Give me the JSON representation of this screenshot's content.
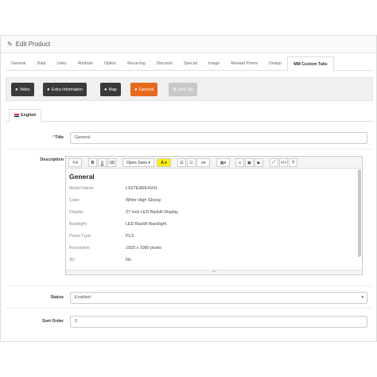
{
  "header": {
    "title": "Edit Product"
  },
  "tabs": [
    {
      "label": "General",
      "active": false
    },
    {
      "label": "Data",
      "active": false
    },
    {
      "label": "Links",
      "active": false
    },
    {
      "label": "Attribute",
      "active": false
    },
    {
      "label": "Option",
      "active": false
    },
    {
      "label": "Recurring",
      "active": false
    },
    {
      "label": "Discount",
      "active": false
    },
    {
      "label": "Special",
      "active": false
    },
    {
      "label": "Image",
      "active": false
    },
    {
      "label": "Reward Points",
      "active": false
    },
    {
      "label": "Design",
      "active": false
    },
    {
      "label": "MM Custom Tabs",
      "active": true
    }
  ],
  "custom_tabs": [
    {
      "label": "Video",
      "style": "dark"
    },
    {
      "label": "Extra Information",
      "style": "dark"
    },
    {
      "label": "Map",
      "style": "dark"
    },
    {
      "label": "General",
      "style": "orange"
    },
    {
      "label": "Add Tab",
      "style": "gray"
    }
  ],
  "language_tab": {
    "label": "English"
  },
  "form": {
    "title_label": "Title",
    "title_value": "General",
    "description_label": "Description",
    "status_label": "Status",
    "status_value": "Enabled",
    "sort_order_label": "Sort Order",
    "sort_order_value": "3"
  },
  "editor": {
    "font_select": "Open Sans",
    "heading": "General",
    "specs": [
      {
        "key": "Model Name",
        "value": "LS27E360HS/XL"
      },
      {
        "key": "Color",
        "value": "White High Glossy"
      },
      {
        "key": "Display",
        "value": "27 inch LED Backlit Display"
      },
      {
        "key": "Backlight",
        "value": "LED Backlit Backlight"
      },
      {
        "key": "Panel Type",
        "value": "PLS"
      },
      {
        "key": "Resolution",
        "value": "1920 x 1080 pixels"
      },
      {
        "key": "3D",
        "value": "No"
      }
    ]
  },
  "colors": {
    "orange": "#e8691c",
    "dark": "#3a3a3a",
    "gray_pill": "#c8c8c8",
    "required": "#d9534f"
  }
}
